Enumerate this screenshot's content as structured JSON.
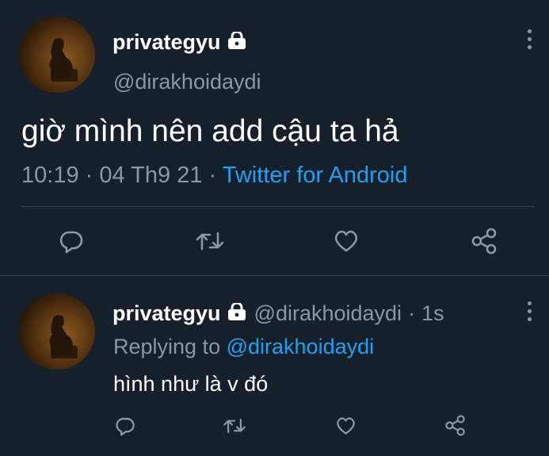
{
  "main_tweet": {
    "display_name": "privategyu",
    "handle": "@dirakhoidaydi",
    "text": "giờ mình nên add cậu ta hả",
    "time": "10:19",
    "date": "04 Th9 21",
    "separator": "·",
    "source": "Twitter for Android"
  },
  "reply_tweet": {
    "display_name": "privategyu",
    "handle": "@dirakhoidaydi",
    "separator": "·",
    "relative_time": "1s",
    "replying_prefix": "Replying to",
    "replying_to": "@dirakhoidaydi",
    "text": "hình như là v đó"
  },
  "colors": {
    "background": "#15202b",
    "text_primary": "#ffffff",
    "text_secondary": "#8899a6",
    "accent": "#1da1f2",
    "divider": "#38444d"
  },
  "icons": [
    "lock-icon",
    "more-options-icon",
    "reply-icon",
    "retweet-icon",
    "like-icon",
    "share-icon"
  ]
}
